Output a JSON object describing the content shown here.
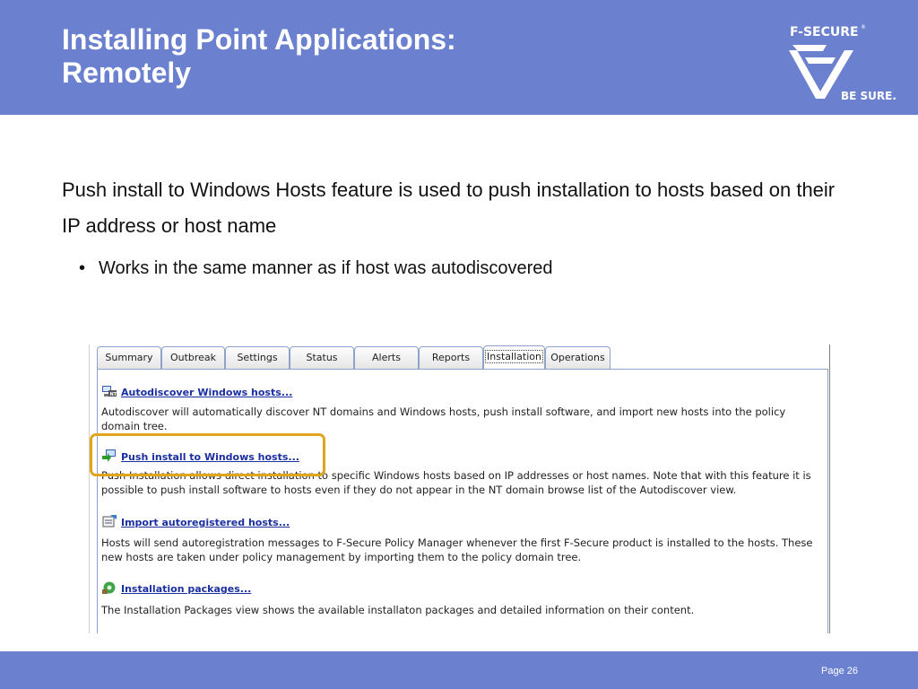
{
  "slide": {
    "title_line1": "Installing Point Applications:",
    "title_line2": "Remotely",
    "intro": "Push install to Windows Hosts feature is used to push installation to hosts based on their IP address or host name",
    "bullet": "Works in the same manner as if host was autodiscovered",
    "page": "Page 26"
  },
  "logo": {
    "brand": "F-SECURE",
    "registered": "®",
    "tagline": "BE SURE."
  },
  "tabs": [
    {
      "label": "Summary"
    },
    {
      "label": "Outbreak"
    },
    {
      "label": "Settings"
    },
    {
      "label": "Status"
    },
    {
      "label": "Alerts"
    },
    {
      "label": "Reports"
    },
    {
      "label": "Installation",
      "active": true
    },
    {
      "label": "Operations"
    }
  ],
  "items": [
    {
      "icon": "network-icon",
      "link": "Autodiscover Windows hosts...",
      "desc": "Autodiscover will automatically discover NT domains and Windows hosts, push install software, and import new hosts into the policy domain tree."
    },
    {
      "icon": "push-install-icon",
      "link": "Push install to Windows hosts...",
      "desc": "Push Installation allows direct installation to specific Windows hosts based on IP addresses or host names. Note that with this feature it is possible to push install software to hosts even if they do not appear in the NT domain browse list of the Autodiscover view."
    },
    {
      "icon": "import-icon",
      "link": "Import autoregistered hosts...",
      "desc": "Hosts will send autoregistration messages to F-Secure Policy Manager whenever the first F-Secure product is installed to the hosts. These new hosts are taken under policy management by importing them to the policy domain tree."
    },
    {
      "icon": "package-icon",
      "link": "Installation packages...",
      "desc": "The Installation Packages view shows the available installaton packages and detailed information on their content."
    }
  ],
  "colors": {
    "header": "#6b80cf",
    "link": "#1a2fa0",
    "highlight": "#e0a51d"
  }
}
